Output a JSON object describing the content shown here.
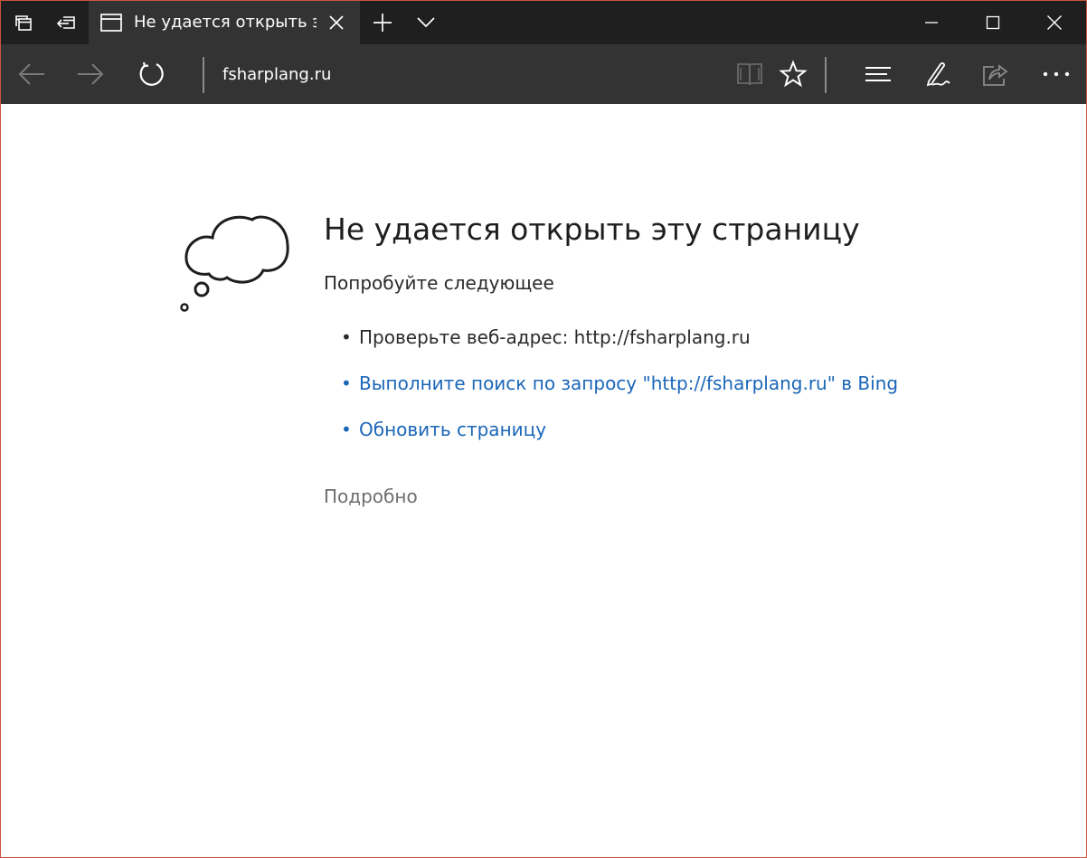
{
  "tab": {
    "title": "Не удается открыть эту страницу"
  },
  "address_bar": {
    "url": "fsharplang.ru"
  },
  "error_page": {
    "title": "Не удается открыть эту страницу",
    "subtitle": "Попробуйте следующее",
    "bullet": "•",
    "suggestions": [
      {
        "text": "Проверьте веб-адрес: http://fsharplang.ru",
        "is_link": false
      },
      {
        "text": "Выполните поиск по запросу \"http://fsharplang.ru\" в Bing",
        "is_link": true
      },
      {
        "text": "Обновить страницу",
        "is_link": true
      }
    ],
    "details_label": "Подробно"
  },
  "icons": {
    "tab_manager": "tabs-icon",
    "set_aside": "set-aside-tabs-icon",
    "tab_page": "page-icon",
    "close_tab": "close-icon",
    "new_tab": "plus-icon",
    "tab_preview": "chevron-down-icon",
    "minimize": "minimize-icon",
    "maximize": "maximize-icon",
    "close_window": "close-icon",
    "back": "back-arrow-icon",
    "forward": "forward-arrow-icon",
    "refresh": "refresh-icon",
    "reading_view": "book-icon",
    "favorite": "star-icon",
    "hub": "hub-icon",
    "web_note": "pen-icon",
    "share": "share-icon",
    "more": "more-icon",
    "error_illustration": "thought-cloud-icon"
  },
  "colors": {
    "titlebar_bg": "#1f1f1f",
    "toolbar_bg": "#333333",
    "link": "#1a66b8",
    "window_border": "#c8553a"
  }
}
